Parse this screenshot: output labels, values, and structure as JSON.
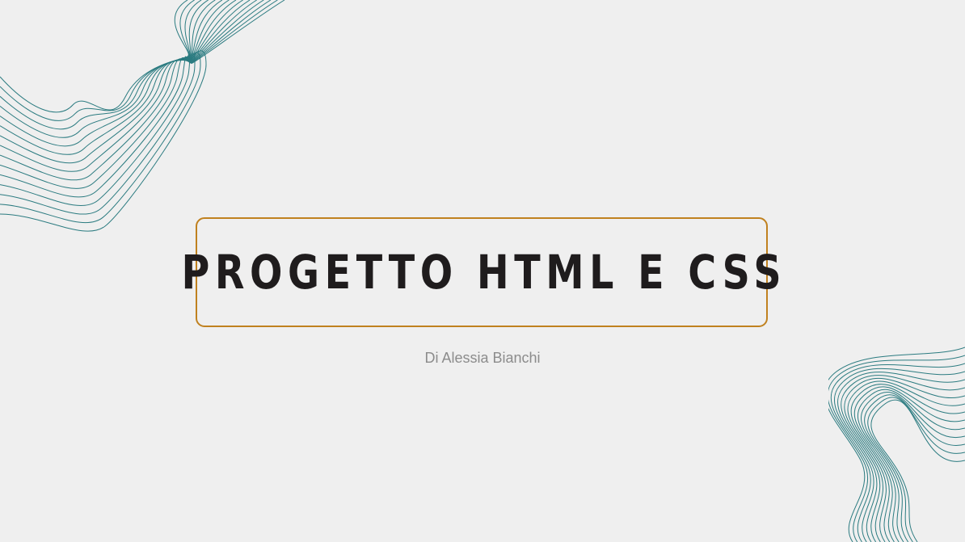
{
  "slide": {
    "title": "PROGETTO HTML E CSS",
    "subtitle": "Di Alessia Bianchi"
  },
  "decorations": {
    "wave_color": "#2b7b80",
    "frame_color": "#c0811f",
    "background_color": "#efefef",
    "title_color": "#1f1c1d",
    "subtitle_color": "#8c8c8c",
    "wave_line_count": 15
  }
}
